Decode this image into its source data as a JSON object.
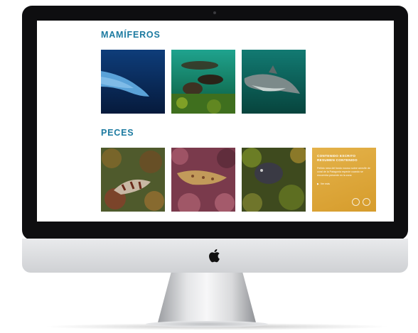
{
  "sections": [
    {
      "title": "MAMÍFEROS"
    },
    {
      "title": "PECES"
    }
  ],
  "info_card": {
    "title": "CONTENIDO ESCRITO RESUMEN CONTENIDO",
    "text": "Pellido ness del fondo rocoso sobre arrecife de coral de la Patagonia especie cuando se encuentra presente en la zona",
    "link": "Ver más"
  },
  "images": {
    "mammals": [
      "whale-photo",
      "sea-lions-photo",
      "dolphin-photo"
    ],
    "fish": [
      "rockfish-photo",
      "spotted-fish-photo",
      "dark-fish-photo"
    ]
  },
  "colors": {
    "accent": "#1c7aa0",
    "card": "#dca438",
    "bezel": "#0e0e10"
  }
}
